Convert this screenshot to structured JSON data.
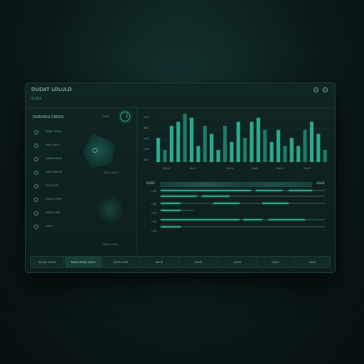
{
  "app": {
    "title": "DUDAT LOLULD",
    "subtitle": "GUIDE"
  },
  "left_panel": {
    "header": "DUEUISIG CADUS",
    "badge": "SAUS",
    "items": [
      {
        "label": "SUNIC TDOH",
        "icon": "circle-icon"
      },
      {
        "label": "LIRG SUICS",
        "icon": "circle-icon"
      },
      {
        "label": "GAIRIK PIDUS",
        "icon": "circle-icon"
      },
      {
        "label": "CAUS DIDUIS",
        "icon": "circle-icon"
      },
      {
        "label": "SOIT DIUS",
        "icon": "circle-icon"
      },
      {
        "label": "CAUSITLIPDS",
        "icon": "circle-icon"
      },
      {
        "label": "IDDUS ASIA",
        "icon": "circle-icon"
      },
      {
        "label": "CAUS",
        "icon": "circle-icon"
      }
    ],
    "note1": "SAUS SIAUS",
    "note2": "LIDUS DUDS"
  },
  "chart_data": {
    "type": "bar",
    "series": [
      {
        "values": [
          6,
          3,
          9,
          10,
          12,
          11,
          4,
          9,
          7,
          3,
          9,
          5,
          10,
          6,
          10,
          11,
          8,
          5,
          8,
          4,
          6,
          4,
          8,
          10,
          7,
          3
        ]
      }
    ],
    "x_tick_labels": [
      "DUUS",
      "TAUS",
      "DUUS",
      "DAAS",
      "DUUS",
      "DUUS"
    ],
    "y_tick_labels": [
      "GAS",
      "BOS",
      "GAS",
      "GOS",
      "AUS"
    ],
    "colors": {
      "bar": "#2aa98b",
      "bar_dim": "#1f7a66"
    }
  },
  "timeline": {
    "label_left": "DUDS",
    "label_right": "GAUS",
    "row_labels": [
      "CAS",
      "CAS",
      "CAS",
      "CAS",
      "CAS"
    ],
    "rows": [
      {
        "start": 0.0,
        "end": 1.0,
        "segments": [
          [
            0.0,
            0.55
          ],
          [
            0.58,
            0.74
          ],
          [
            0.78,
            0.92
          ]
        ]
      },
      {
        "start": 0.0,
        "end": 1.0,
        "segments": [
          [
            0.0,
            0.22
          ],
          [
            0.25,
            0.42
          ]
        ]
      },
      {
        "start": 0.0,
        "end": 1.0,
        "segments": [
          [
            0.0,
            0.12
          ],
          [
            0.32,
            0.48
          ],
          [
            0.62,
            0.78
          ]
        ]
      },
      {
        "start": 0.0,
        "end": 0.2,
        "segments": [
          [
            0.0,
            0.12
          ]
        ]
      }
    ]
  },
  "footer": {
    "buttons": [
      "UDULS DUUS",
      "DAUS DUDS UAUS",
      "DUGS AUIS",
      "DAUS",
      "GAUS",
      "DAUS",
      "UAUS",
      "GAUS"
    ],
    "active_index": 1
  }
}
